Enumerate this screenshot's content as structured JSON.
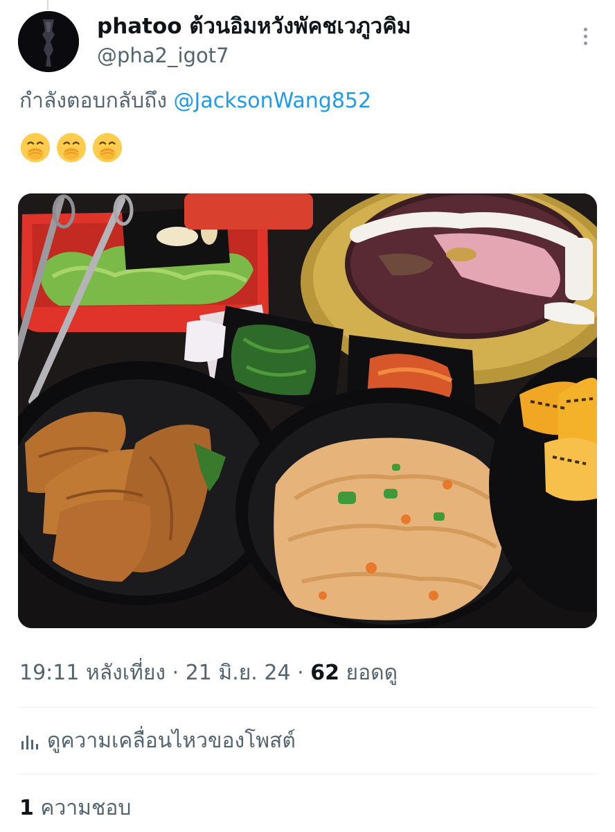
{
  "tweet": {
    "author": {
      "display_name": "phatoo ต้วนอิมหวังพัคชเวภูวคิม",
      "handle": "@pha2_igot7"
    },
    "reply_context": {
      "prefix": "กำลังตอบกลับถึง",
      "mention": "@JacksonWang852"
    },
    "emojis": [
      {
        "name": "face-with-hand-over-mouth-icon"
      },
      {
        "name": "face-with-hand-over-mouth-icon"
      },
      {
        "name": "face-with-hand-over-mouth-icon"
      }
    ],
    "meta": {
      "time": "19:11 หลังเที่ยง",
      "separator": "·",
      "date": "21 มิ.ย. 24",
      "views_count": "62",
      "views_label": "ยอดดู"
    },
    "activity": {
      "icon": "analytics-icon",
      "label": "ดูความเคลื่อนไหวของโพสต์"
    },
    "likes": {
      "count": "1",
      "label": "ความชอบ"
    }
  },
  "colors": {
    "text_primary": "#0f1419",
    "text_secondary": "#536471",
    "link": "#1d9bf0",
    "divider": "#eff3f4"
  }
}
